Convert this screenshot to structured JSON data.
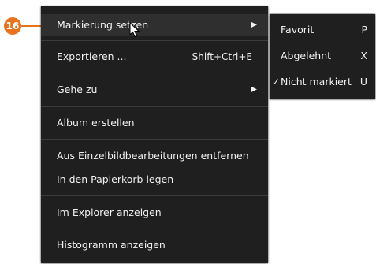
{
  "callout": {
    "number": "16"
  },
  "menu": {
    "items": [
      {
        "label": "Markierung setzen",
        "has_submenu": true
      },
      {
        "label": "Exportieren ...",
        "shortcut": "Shift+Ctrl+E"
      },
      {
        "label": "Gehe zu",
        "has_submenu": true
      },
      {
        "label": "Album erstellen"
      },
      {
        "label": "Aus Einzelbildbearbeitungen entfernen"
      },
      {
        "label": "In den Papierkorb legen"
      },
      {
        "label": "Im Explorer anzeigen"
      },
      {
        "label": "Histogramm anzeigen"
      }
    ],
    "submenu_arrow": "▶"
  },
  "submenu": {
    "items": [
      {
        "label": "Favorit",
        "key": "P"
      },
      {
        "label": "Abgelehnt",
        "key": "X"
      },
      {
        "label": "Nicht markiert",
        "key": "U",
        "checked": true,
        "check_mark": "✓"
      }
    ]
  },
  "colors": {
    "menu_bg": "#1f1f1f",
    "hover_bg": "#2f2f2f",
    "separator": "#3b3b3b",
    "text": "#f0f0f0",
    "callout": "#e8731f"
  }
}
